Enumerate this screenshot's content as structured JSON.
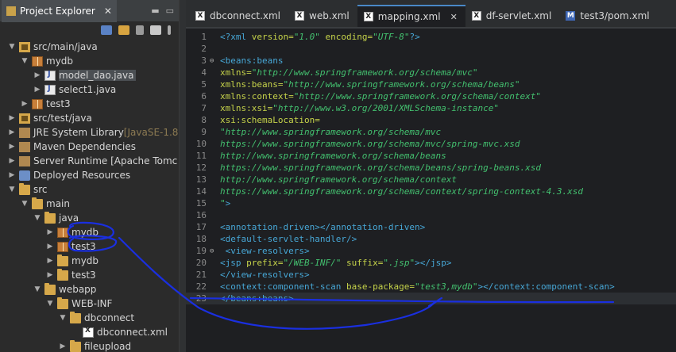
{
  "explorer": {
    "title": "Project Explorer",
    "tree": [
      {
        "label": "src/main/java",
        "decor": "",
        "indent": 0,
        "expanded": true,
        "icon": "source-folder-icon"
      },
      {
        "label": "mydb",
        "decor": "",
        "indent": 1,
        "expanded": true,
        "icon": "package-icon"
      },
      {
        "label": "model_dao.java",
        "decor": "",
        "indent": 2,
        "expanded": false,
        "icon": "java-file-icon",
        "selected": true
      },
      {
        "label": "select1.java",
        "decor": "",
        "indent": 2,
        "expanded": false,
        "icon": "java-file-icon"
      },
      {
        "label": "test3",
        "decor": "",
        "indent": 1,
        "expanded": false,
        "icon": "package-icon"
      },
      {
        "label": "src/test/java",
        "decor": "",
        "indent": 0,
        "expanded": false,
        "icon": "source-folder-icon"
      },
      {
        "label": "JRE System Library ",
        "decor": "[JavaSE-1.8",
        "indent": 0,
        "expanded": false,
        "icon": "library-icon"
      },
      {
        "label": "Maven Dependencies",
        "decor": "",
        "indent": 0,
        "expanded": false,
        "icon": "library-icon"
      },
      {
        "label": "Server Runtime [Apache Tomc",
        "decor": "",
        "indent": 0,
        "expanded": false,
        "icon": "library-icon"
      },
      {
        "label": "Deployed Resources",
        "decor": "",
        "indent": 0,
        "expanded": false,
        "icon": "web-resources-icon"
      },
      {
        "label": "src",
        "decor": "",
        "indent": 0,
        "expanded": true,
        "icon": "folder-icon"
      },
      {
        "label": "main",
        "decor": "",
        "indent": 1,
        "expanded": true,
        "icon": "folder-icon"
      },
      {
        "label": "java",
        "decor": "",
        "indent": 2,
        "expanded": true,
        "icon": "folder-icon"
      },
      {
        "label": "mydb",
        "decor": "",
        "indent": 3,
        "expanded": false,
        "icon": "package-icon"
      },
      {
        "label": "test3",
        "decor": "",
        "indent": 3,
        "expanded": false,
        "icon": "package-icon"
      },
      {
        "label": "mydb",
        "decor": "",
        "indent": 3,
        "expanded": false,
        "icon": "folder-icon"
      },
      {
        "label": "test3",
        "decor": "",
        "indent": 3,
        "expanded": false,
        "icon": "folder-icon"
      },
      {
        "label": "webapp",
        "decor": "",
        "indent": 2,
        "expanded": true,
        "icon": "folder-icon"
      },
      {
        "label": "WEB-INF",
        "decor": "",
        "indent": 3,
        "expanded": true,
        "icon": "folder-icon"
      },
      {
        "label": "dbconnect",
        "decor": "",
        "indent": 4,
        "expanded": true,
        "icon": "folder-icon"
      },
      {
        "label": "dbconnect.xml",
        "decor": "",
        "indent": 5,
        "expanded": false,
        "icon": "xml-file-icon",
        "leaf": true
      },
      {
        "label": "fileupload",
        "decor": "",
        "indent": 4,
        "expanded": false,
        "icon": "folder-icon"
      }
    ]
  },
  "editor": {
    "tabs": [
      {
        "label": "dbconnect.xml",
        "icon": "xml-file-icon",
        "active": false
      },
      {
        "label": "web.xml",
        "icon": "xml-file-icon",
        "active": false
      },
      {
        "label": "mapping.xml",
        "icon": "xml-file-icon",
        "active": true
      },
      {
        "label": "df-servlet.xml",
        "icon": "xml-file-icon",
        "active": false
      },
      {
        "label": "test3/pom.xml",
        "icon": "maven-pom-icon",
        "active": false
      }
    ],
    "lines": [
      {
        "n": "1",
        "parts": [
          [
            "pi",
            "<?xml "
          ],
          [
            "attr",
            "version="
          ],
          [
            "str",
            "\"1.0\""
          ],
          [
            "plain",
            " "
          ],
          [
            "attr",
            "encoding="
          ],
          [
            "str",
            "\"UTF-8\""
          ],
          [
            "pi",
            "?>"
          ]
        ]
      },
      {
        "n": "2",
        "parts": []
      },
      {
        "n": "3",
        "fold": true,
        "parts": [
          [
            "tag",
            "<beans:beans"
          ]
        ]
      },
      {
        "n": "4",
        "parts": [
          [
            "attr",
            "xmlns="
          ],
          [
            "str",
            "\"http://www.springframework.org/schema/mvc\""
          ]
        ]
      },
      {
        "n": "5",
        "parts": [
          [
            "attr",
            "xmlns:beans="
          ],
          [
            "str",
            "\"http://www.springframework.org/schema/beans\""
          ]
        ]
      },
      {
        "n": "6",
        "parts": [
          [
            "attr",
            "xmlns:context="
          ],
          [
            "str",
            "\"http://www.springframework.org/schema/context\""
          ]
        ]
      },
      {
        "n": "7",
        "parts": [
          [
            "attr",
            "xmlns:xsi="
          ],
          [
            "str",
            "\"http://www.w3.org/2001/XMLSchema-instance\""
          ]
        ]
      },
      {
        "n": "8",
        "parts": [
          [
            "attr",
            "xsi:schemaLocation="
          ]
        ]
      },
      {
        "n": "9",
        "parts": [
          [
            "str",
            "\"http://www.springframework.org/schema/mvc"
          ]
        ]
      },
      {
        "n": "10",
        "parts": [
          [
            "str",
            "https://www.springframework.org/schema/mvc/spring-mvc.xsd"
          ]
        ]
      },
      {
        "n": "11",
        "parts": [
          [
            "str",
            "http://www.springframework.org/schema/beans"
          ]
        ]
      },
      {
        "n": "12",
        "parts": [
          [
            "str",
            "https://www.springframework.org/schema/beans/spring-beans.xsd"
          ]
        ]
      },
      {
        "n": "13",
        "parts": [
          [
            "str",
            "http://www.springframework.org/schema/context"
          ]
        ]
      },
      {
        "n": "14",
        "parts": [
          [
            "str",
            "https://www.springframework.org/schema/context/spring-context-4.3.xsd"
          ]
        ]
      },
      {
        "n": "15",
        "parts": [
          [
            "str",
            "\""
          ],
          [
            "tag",
            ">"
          ]
        ]
      },
      {
        "n": "16",
        "parts": []
      },
      {
        "n": "17",
        "parts": [
          [
            "tag",
            "<annotation-driven></annotation-driven>"
          ]
        ]
      },
      {
        "n": "18",
        "parts": [
          [
            "tag",
            "<default-servlet-handler/>"
          ]
        ]
      },
      {
        "n": "19",
        "fold": true,
        "parts": [
          [
            "plain",
            " "
          ],
          [
            "tag",
            "<view-resolvers>"
          ]
        ]
      },
      {
        "n": "20",
        "parts": [
          [
            "tag",
            "<jsp "
          ],
          [
            "attr",
            "prefix="
          ],
          [
            "str",
            "\"/WEB-INF/\""
          ],
          [
            "plain",
            " "
          ],
          [
            "attr",
            "suffix="
          ],
          [
            "str",
            "\".jsp\""
          ],
          [
            "tag",
            "></jsp>"
          ]
        ]
      },
      {
        "n": "21",
        "parts": [
          [
            "tag",
            "</view-resolvers>"
          ]
        ]
      },
      {
        "n": "22",
        "parts": [
          [
            "tag",
            "<context:component-scan "
          ],
          [
            "attr",
            "base-package="
          ],
          [
            "str",
            "\"test3,mydb\""
          ],
          [
            "tag",
            "></context:component-scan>"
          ]
        ]
      },
      {
        "n": "23",
        "current": true,
        "parts": [
          [
            "tag",
            "</beans:beans>"
          ]
        ]
      }
    ]
  },
  "colors": {
    "annotation_ink": "#1a2fe0"
  }
}
